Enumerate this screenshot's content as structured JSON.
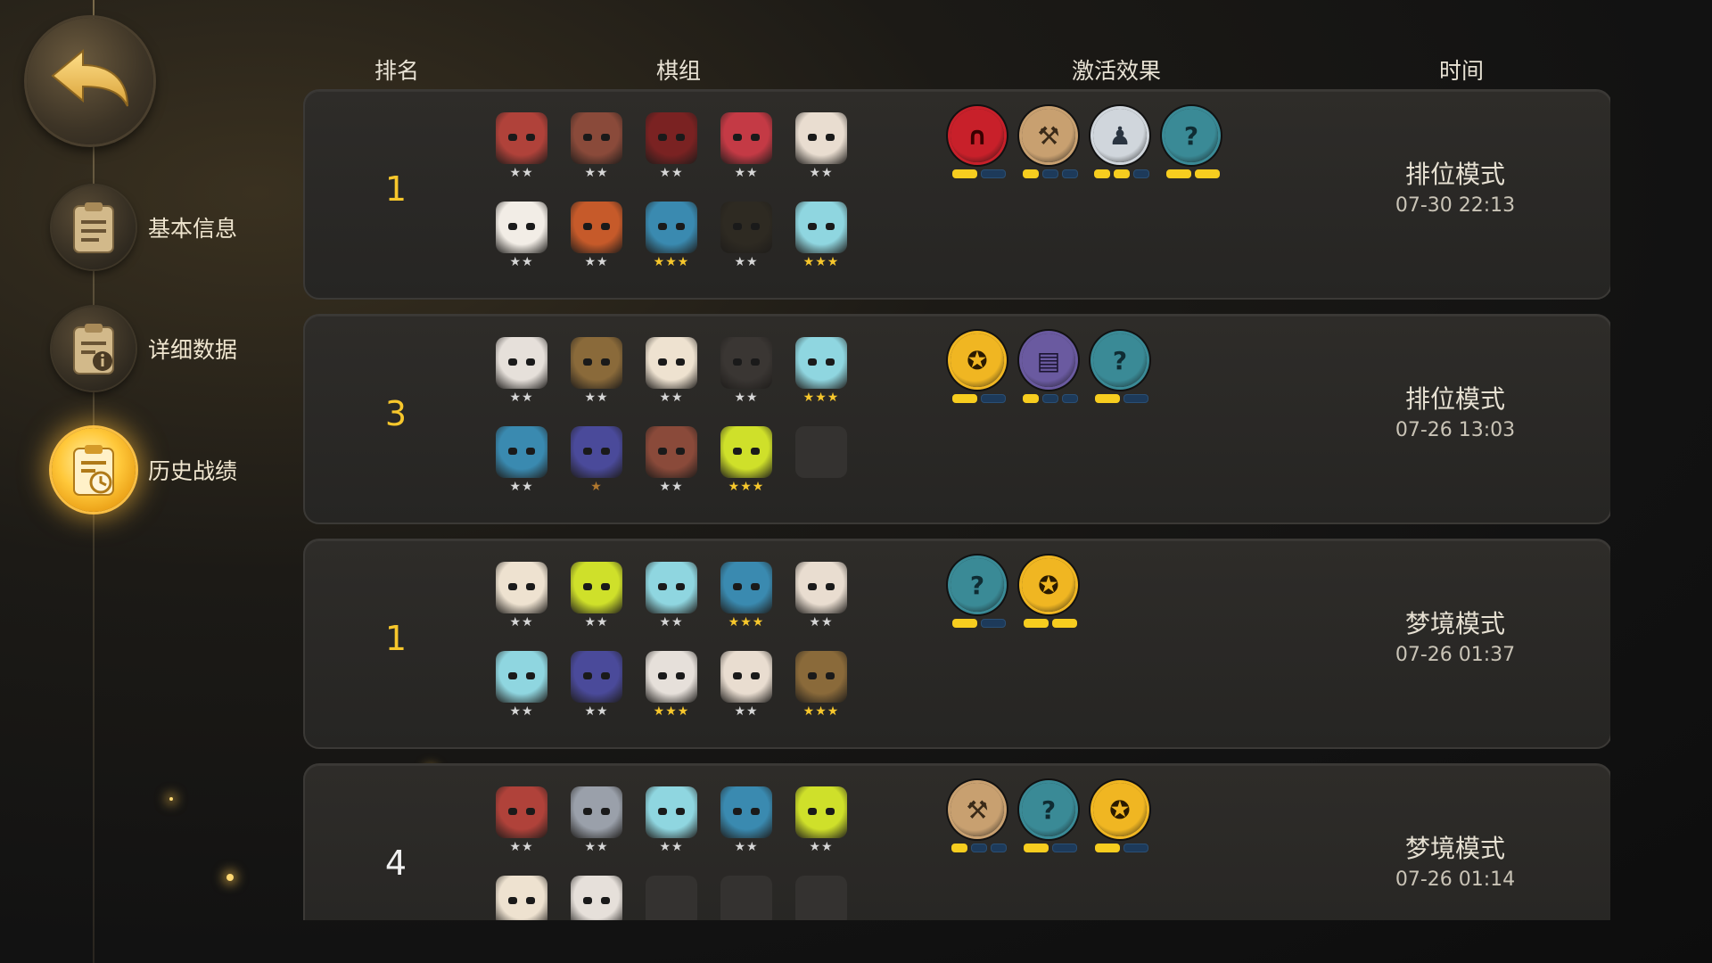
{
  "nav": {
    "back_icon": "back-arrow-icon",
    "items": [
      {
        "label": "基本信息",
        "icon": "document-icon",
        "active": false
      },
      {
        "label": "详细数据",
        "icon": "document-info-icon",
        "active": false
      },
      {
        "label": "历史战绩",
        "icon": "history-clock-icon",
        "active": true
      }
    ]
  },
  "table": {
    "headers": {
      "rank": "排名",
      "lineup": "棋组",
      "effects": "激活效果",
      "time": "时间"
    },
    "rows": [
      {
        "rank": "1",
        "rank_color": "#f7c72c",
        "mode": "排位模式",
        "time": "07-30 22:13",
        "units_row1": [
          {
            "color": "#b0423a",
            "stars": 2,
            "tier": "silver"
          },
          {
            "color": "#8a4a3a",
            "stars": 2,
            "tier": "silver"
          },
          {
            "color": "#7a2222",
            "stars": 2,
            "tier": "silver"
          },
          {
            "color": "#c43a45",
            "stars": 2,
            "tier": "silver"
          },
          {
            "color": "#e9ddd0",
            "stars": 2,
            "tier": "silver"
          }
        ],
        "units_row2": [
          {
            "color": "#f2ede6",
            "stars": 2,
            "tier": "silver"
          },
          {
            "color": "#c65a2a",
            "stars": 2,
            "tier": "silver"
          },
          {
            "color": "#3a8ab0",
            "stars": 3,
            "tier": "gold"
          },
          {
            "color": "#2e2a22",
            "stars": 2,
            "tier": "silver"
          },
          {
            "color": "#8fd6e0",
            "stars": 3,
            "tier": "gold"
          }
        ],
        "traits": [
          {
            "icon": "arch-icon",
            "color": "#c8202a",
            "fg": "#3a0000",
            "active": 1,
            "total": 2
          },
          {
            "icon": "axe-icon",
            "color": "#c8a070",
            "fg": "#3a2a18",
            "active": 1,
            "total": 3
          },
          {
            "icon": "bust-icon",
            "color": "#d0d6dc",
            "fg": "#2a3440",
            "active": 2,
            "total": 3
          },
          {
            "icon": "swirl-icon",
            "color": "#3a8a96",
            "fg": "#0f2c33",
            "active": 2,
            "total": 2
          }
        ]
      },
      {
        "rank": "3",
        "rank_color": "#f7c72c",
        "mode": "排位模式",
        "time": "07-26 13:03",
        "units_row1": [
          {
            "color": "#e6e0da",
            "stars": 2,
            "tier": "silver"
          },
          {
            "color": "#8a6a3a",
            "stars": 2,
            "tier": "silver"
          },
          {
            "color": "#eee2d0",
            "stars": 2,
            "tier": "silver"
          },
          {
            "color": "#3a3633",
            "stars": 2,
            "tier": "silver"
          },
          {
            "color": "#8fd6e0",
            "stars": 3,
            "tier": "gold"
          }
        ],
        "units_row2": [
          {
            "color": "#3a8ab0",
            "stars": 2,
            "tier": "silver"
          },
          {
            "color": "#4a4a9a",
            "stars": 1,
            "tier": "bronze"
          },
          {
            "color": "#8a4a3a",
            "stars": 2,
            "tier": "silver"
          },
          {
            "color": "#cfe02a",
            "stars": 3,
            "tier": "gold"
          },
          {
            "color": "",
            "stars": 0,
            "tier": "empty"
          }
        ],
        "traits": [
          {
            "icon": "keyhole-icon",
            "color": "#f0b622",
            "fg": "#2a1a00",
            "active": 1,
            "total": 2
          },
          {
            "icon": "book-icon",
            "color": "#6a5aa0",
            "fg": "#1a1430",
            "active": 1,
            "total": 3
          },
          {
            "icon": "swirl-icon",
            "color": "#3a8a96",
            "fg": "#0f2c33",
            "active": 1,
            "total": 2
          }
        ]
      },
      {
        "rank": "1",
        "rank_color": "#f7c72c",
        "mode": "梦境模式",
        "time": "07-26 01:37",
        "units_row1": [
          {
            "color": "#eee2d0",
            "stars": 2,
            "tier": "silver"
          },
          {
            "color": "#cfe02a",
            "stars": 2,
            "tier": "silver"
          },
          {
            "color": "#8fd6e0",
            "stars": 2,
            "tier": "silver"
          },
          {
            "color": "#3a8ab0",
            "stars": 3,
            "tier": "gold"
          },
          {
            "color": "#e9ddd0",
            "stars": 2,
            "tier": "silver"
          }
        ],
        "units_row2": [
          {
            "color": "#8fd6e0",
            "stars": 2,
            "tier": "silver"
          },
          {
            "color": "#4a4a9a",
            "stars": 2,
            "tier": "silver"
          },
          {
            "color": "#e6e0da",
            "stars": 3,
            "tier": "gold"
          },
          {
            "color": "#e9ddd0",
            "stars": 2,
            "tier": "silver"
          },
          {
            "color": "#8a6a3a",
            "stars": 3,
            "tier": "gold"
          }
        ],
        "traits": [
          {
            "icon": "swirl-icon",
            "color": "#3a8a96",
            "fg": "#0f2c33",
            "active": 1,
            "total": 2
          },
          {
            "icon": "keyhole-icon",
            "color": "#f0b622",
            "fg": "#2a1a00",
            "active": 2,
            "total": 2
          }
        ]
      },
      {
        "rank": "4",
        "rank_color": "#f0f0f0",
        "mode": "梦境模式",
        "time": "07-26 01:14",
        "units_row1": [
          {
            "color": "#b0423a",
            "stars": 2,
            "tier": "silver"
          },
          {
            "color": "#9aa0aa",
            "stars": 2,
            "tier": "silver"
          },
          {
            "color": "#8fd6e0",
            "stars": 2,
            "tier": "silver"
          },
          {
            "color": "#3a8ab0",
            "stars": 2,
            "tier": "silver"
          },
          {
            "color": "#cfe02a",
            "stars": 2,
            "tier": "silver"
          }
        ],
        "units_row2": [
          {
            "color": "#eee2d0",
            "stars": 0,
            "tier": "silver"
          },
          {
            "color": "#e6e0da",
            "stars": 0,
            "tier": "silver"
          },
          {
            "color": "",
            "stars": 0,
            "tier": "empty"
          },
          {
            "color": "",
            "stars": 0,
            "tier": "empty"
          },
          {
            "color": "",
            "stars": 0,
            "tier": "empty"
          }
        ],
        "traits": [
          {
            "icon": "axe-icon",
            "color": "#c8a070",
            "fg": "#3a2a18",
            "active": 1,
            "total": 3
          },
          {
            "icon": "swirl-icon",
            "color": "#3a8a96",
            "fg": "#0f2c33",
            "active": 1,
            "total": 2
          },
          {
            "icon": "keyhole-icon",
            "color": "#f0b622",
            "fg": "#2a1a00",
            "active": 1,
            "total": 2
          }
        ]
      }
    ]
  }
}
